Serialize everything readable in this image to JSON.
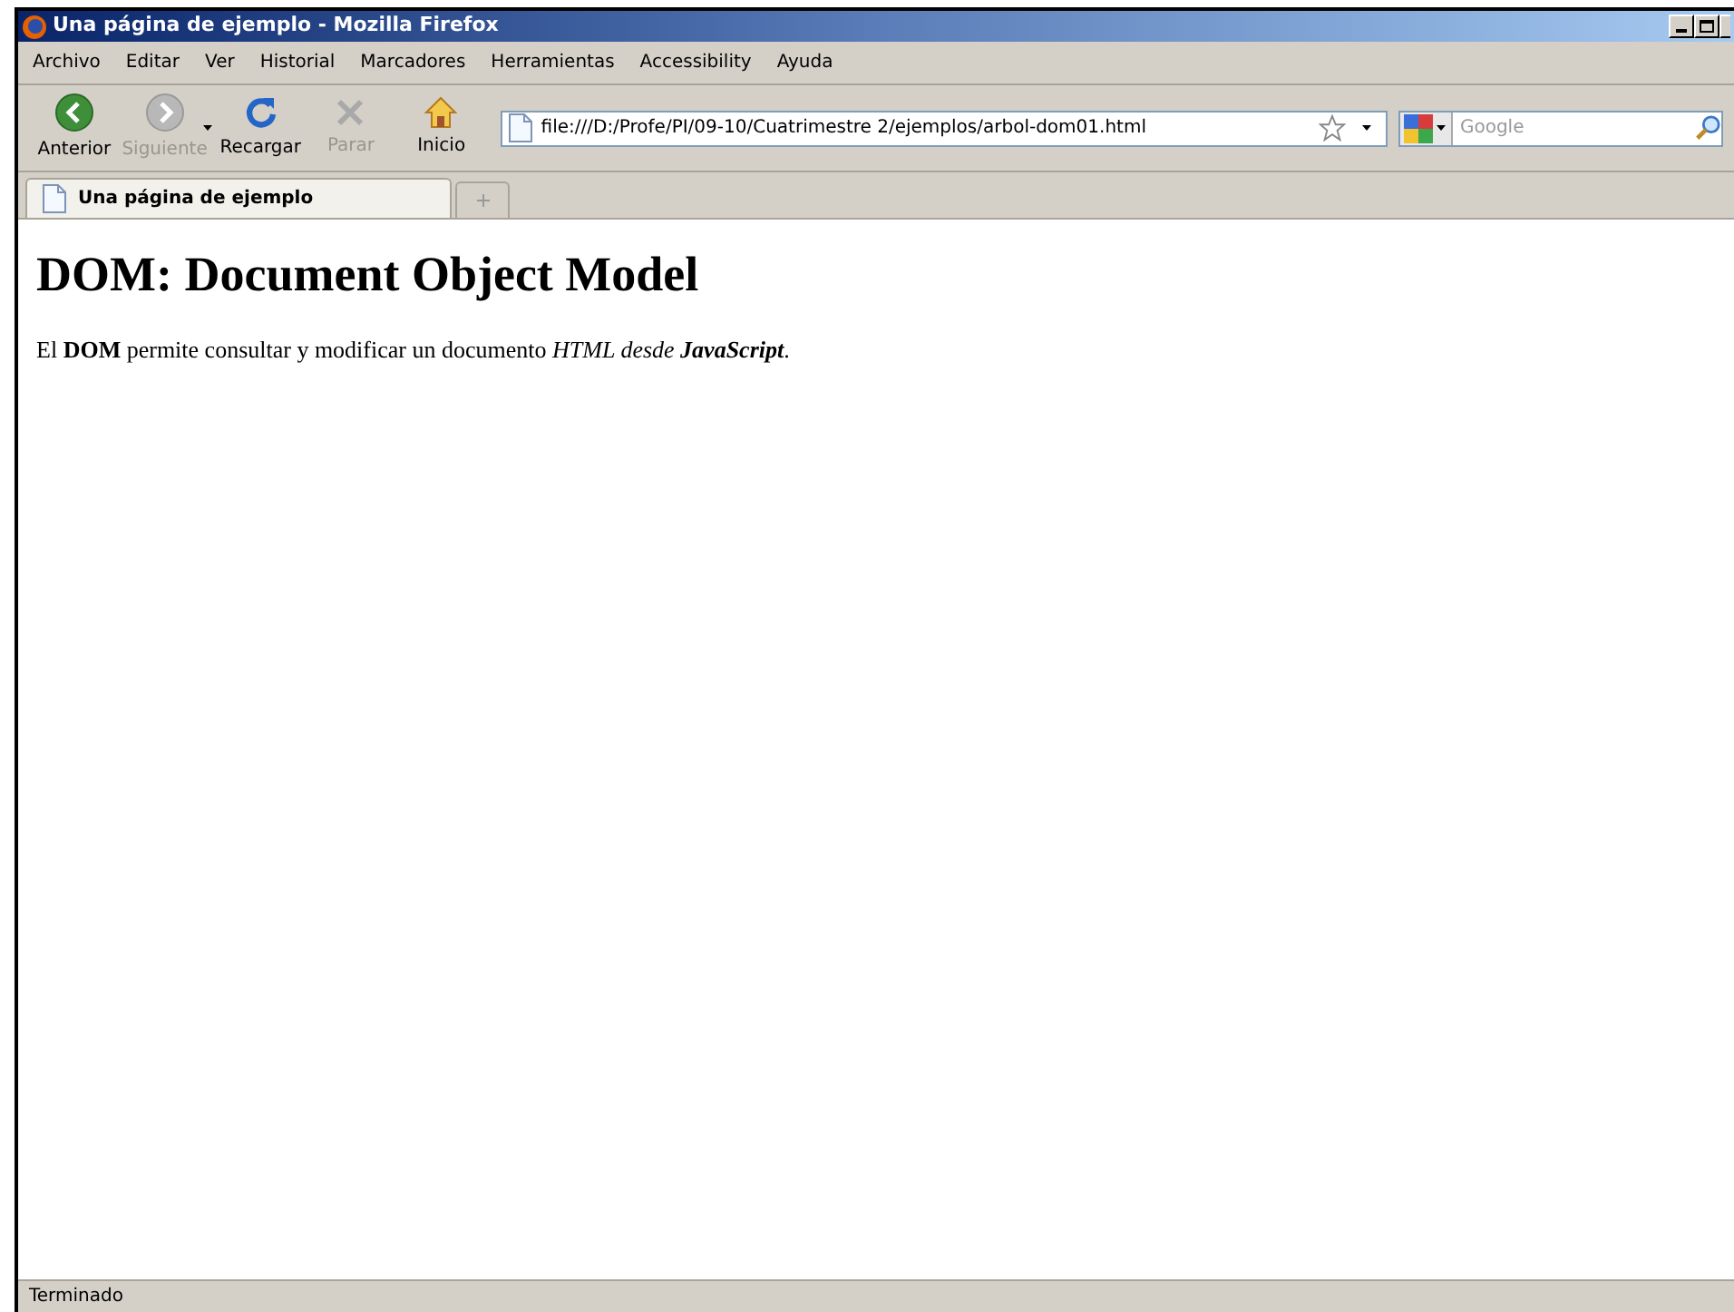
{
  "window": {
    "title": "Una página de ejemplo - Mozilla Firefox"
  },
  "menu": [
    "Archivo",
    "Editar",
    "Ver",
    "Historial",
    "Marcadores",
    "Herramientas",
    "Accessibility",
    "Ayuda"
  ],
  "toolbar": [
    {
      "kind": "back",
      "label": "Anterior",
      "disabled": false
    },
    {
      "kind": "forward",
      "label": "Siguiente",
      "disabled": true
    },
    {
      "kind": "reload",
      "label": "Recargar",
      "disabled": false
    },
    {
      "kind": "stop",
      "label": "Parar",
      "disabled": true
    },
    {
      "kind": "home",
      "label": "Inicio",
      "disabled": false
    }
  ],
  "address_bar": {
    "value": "file:///D:/Profe/PI/09-10/Cuatrimestre 2/ejemplos/arbol-dom01.html"
  },
  "search": {
    "placeholder": "Google"
  },
  "tabs": [
    {
      "label": "Una página de ejemplo",
      "selected": true
    }
  ],
  "page": {
    "heading": "DOM: Document Object Model",
    "paragraph": "El **DOM** permite consultar y modificar un documento *HTML desde* **JavaScript**."
  },
  "status_bar": "Terminado"
}
